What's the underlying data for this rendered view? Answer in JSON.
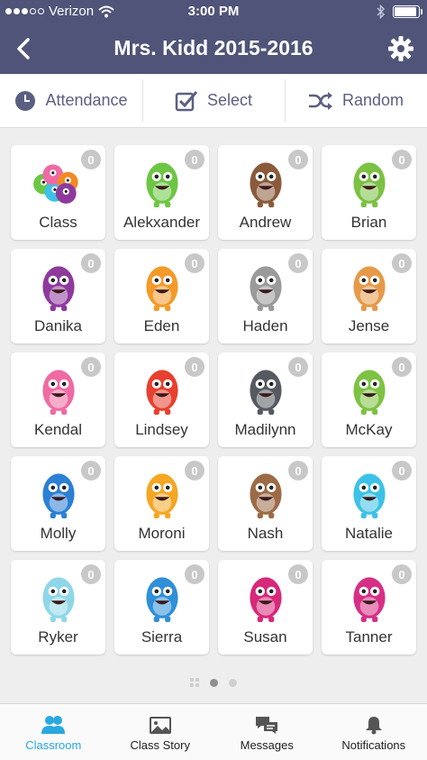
{
  "status_bar": {
    "carrier": "Verizon",
    "time": "3:00 PM"
  },
  "header": {
    "title": "Mrs. Kidd 2015-2016"
  },
  "toolbar": {
    "attendance": "Attendance",
    "select": "Select",
    "random": "Random"
  },
  "students": [
    {
      "name": "Class",
      "points": "0",
      "color": "#f08a24"
    },
    {
      "name": "Alekxander",
      "points": "0",
      "color": "#6cc644"
    },
    {
      "name": "Andrew",
      "points": "0",
      "color": "#8a5a3a"
    },
    {
      "name": "Brian",
      "points": "0",
      "color": "#7bc143"
    },
    {
      "name": "Danika",
      "points": "0",
      "color": "#8e3a9d"
    },
    {
      "name": "Eden",
      "points": "0",
      "color": "#f39a2a"
    },
    {
      "name": "Haden",
      "points": "0",
      "color": "#9a9a9a"
    },
    {
      "name": "Jense",
      "points": "0",
      "color": "#e59a4a"
    },
    {
      "name": "Kendal",
      "points": "0",
      "color": "#ef6aa3"
    },
    {
      "name": "Lindsey",
      "points": "0",
      "color": "#e8402e"
    },
    {
      "name": "Madilynn",
      "points": "0",
      "color": "#555a60"
    },
    {
      "name": "McKay",
      "points": "0",
      "color": "#7dc242"
    },
    {
      "name": "Molly",
      "points": "0",
      "color": "#2b7fd4"
    },
    {
      "name": "Moroni",
      "points": "0",
      "color": "#f5a623"
    },
    {
      "name": "Nash",
      "points": "0",
      "color": "#9c6b45"
    },
    {
      "name": "Natalie",
      "points": "0",
      "color": "#3cc2e6"
    },
    {
      "name": "Ryker",
      "points": "0",
      "color": "#8fd7e8"
    },
    {
      "name": "Sierra",
      "points": "0",
      "color": "#2f8fd8"
    },
    {
      "name": "Susan",
      "points": "0",
      "color": "#d8287a"
    },
    {
      "name": "Tanner",
      "points": "0",
      "color": "#d62f86"
    }
  ],
  "tabs": [
    {
      "label": "Classroom",
      "icon": "classroom-icon"
    },
    {
      "label": "Class Story",
      "icon": "class-story-icon"
    },
    {
      "label": "Messages",
      "icon": "messages-icon"
    },
    {
      "label": "Notifications",
      "icon": "notifications-icon"
    }
  ],
  "colors": {
    "header": "#4f5478",
    "accent": "#2aa8e0",
    "toolbar_text": "#5a5f82"
  }
}
